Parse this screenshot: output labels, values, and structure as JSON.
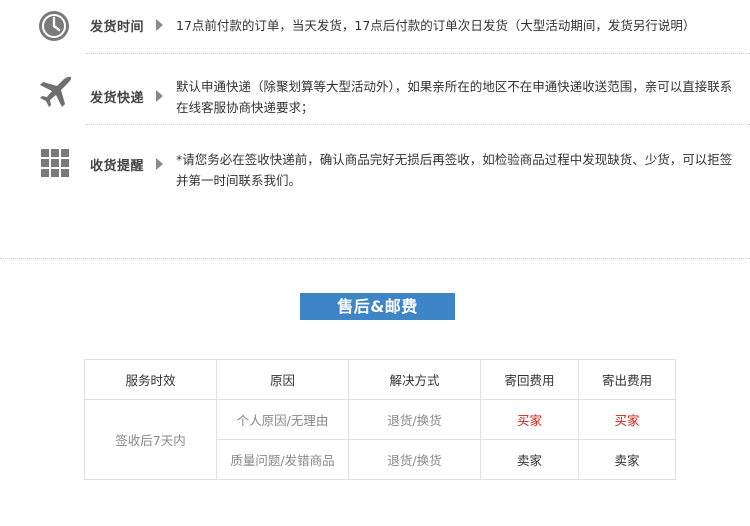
{
  "shipping": {
    "rows": [
      {
        "icon": "clock-icon",
        "label": "发货时间",
        "text": "17点前付款的订单，当天发货，17点后付款的订单次日发货（大型活动期间，发货另行说明）"
      },
      {
        "icon": "airplane-icon",
        "label": "发货快递",
        "text": "默认申通快递（除聚划算等大型活动外），如果亲所在的地区不在申通快递收送范围，亲可以直接联系在线客服协商快递要求；"
      },
      {
        "icon": "grid-icon",
        "label": "收货提醒",
        "text": "*请您务必在签收快递前，确认商品完好无损后再签收，如检验商品过程中发现缺货、少货，可以拒签并第一时间联系我们。"
      }
    ]
  },
  "after_sales": {
    "title": "售后&邮费",
    "headers": [
      "服务时效",
      "原因",
      "解决方式",
      "寄回费用",
      "寄出费用"
    ],
    "period": "签收后7天内",
    "rows": [
      {
        "reason": "个人原因/无理由",
        "solution": "退货/换货",
        "return_fee": "买家",
        "send_fee": "买家"
      },
      {
        "reason": "质量问题/发错商品",
        "solution": "退货/换货",
        "return_fee": "卖家",
        "send_fee": "卖家"
      }
    ]
  },
  "colors": {
    "accent": "#3d85c6",
    "buyer_fee": "#d0221b",
    "icon_gray": "#7a7a7a"
  }
}
